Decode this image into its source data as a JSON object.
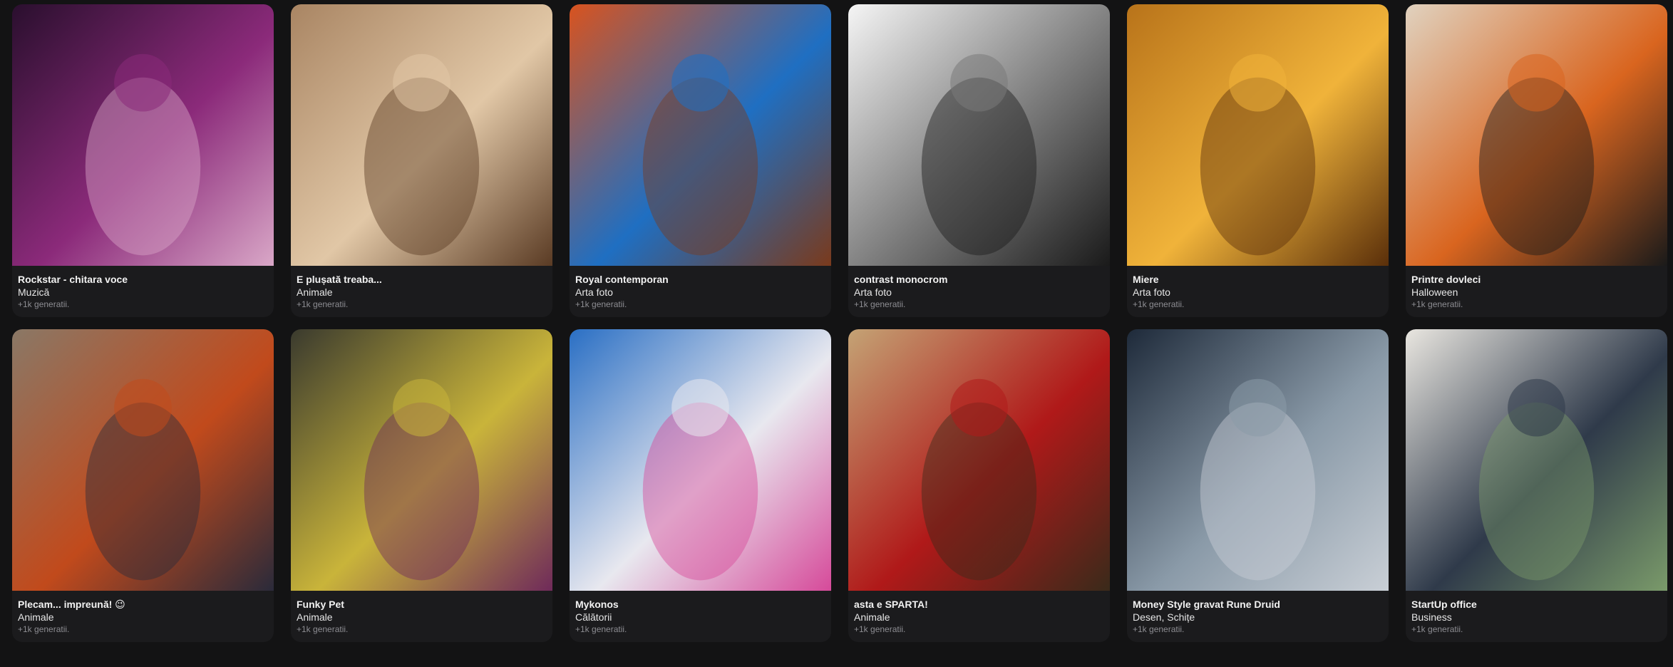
{
  "gallery": {
    "cards": [
      {
        "title": "Rockstar - chitara voce",
        "category": "Muzică",
        "count": "+1k generatii.",
        "image": "rockstar-concert",
        "palette": [
          "#2a0f2e",
          "#8b2a7a",
          "#d9a7c7"
        ]
      },
      {
        "title": "E plușată treaba...",
        "category": "Animale",
        "count": "+1k generatii.",
        "image": "plush-puppies",
        "palette": [
          "#a98563",
          "#e1c7a6",
          "#5a3b24"
        ]
      },
      {
        "title": "Royal contemporan",
        "category": "Arta foto",
        "count": "+1k generatii.",
        "image": "woman-floral-dress",
        "palette": [
          "#d9531e",
          "#1f6fc2",
          "#7a3a1c"
        ]
      },
      {
        "title": "contrast monocrom",
        "category": "Arta foto",
        "count": "+1k generatii.",
        "image": "monochrome-portrait",
        "palette": [
          "#f5f5f5",
          "#7a7a7a",
          "#1a1a1a"
        ]
      },
      {
        "title": "Miere",
        "category": "Arta foto",
        "count": "+1k generatii.",
        "image": "honey-face",
        "palette": [
          "#b8731a",
          "#f0b33a",
          "#5a2f0a"
        ]
      },
      {
        "title": "Printre dovleci",
        "category": "Halloween",
        "count": "+1k generatii.",
        "image": "witch-pumpkins",
        "palette": [
          "#e0d2bf",
          "#d9651f",
          "#1a1a1a"
        ]
      },
      {
        "title": "Plecam... impreună! 😉",
        "category": "Animale",
        "count": "+1k generatii.",
        "image": "traveler-with-dog",
        "palette": [
          "#8a7866",
          "#c14a1c",
          "#2a2a3a"
        ]
      },
      {
        "title": "Funky Pet",
        "category": "Animale",
        "count": "+1k generatii.",
        "image": "dog-sunglasses-alley",
        "palette": [
          "#3a3a2e",
          "#c9b43a",
          "#6f2a5a"
        ]
      },
      {
        "title": "Mykonos",
        "category": "Călătorii",
        "count": "+1k generatii.",
        "image": "mykonos-photographer",
        "palette": [
          "#2a6fc4",
          "#e8e8ef",
          "#d64a9a"
        ]
      },
      {
        "title": "asta e SPARTA!",
        "category": "Animale",
        "count": "+1k generatii.",
        "image": "spartan-dalmatian",
        "palette": [
          "#c4a375",
          "#b01919",
          "#3a2a1a"
        ]
      },
      {
        "title": "Money Style gravat Rune Druid",
        "category": "Desen, Schițe",
        "count": "+1k generatii.",
        "image": "engraved-druid",
        "palette": [
          "#1e2a3a",
          "#8a9aa8",
          "#c9cfd6"
        ]
      },
      {
        "title": "StartUp office",
        "category": "Business",
        "count": "+1k generatii.",
        "image": "office-woman",
        "palette": [
          "#e9e6e0",
          "#2f3a4a",
          "#7a9a6a"
        ]
      }
    ]
  }
}
